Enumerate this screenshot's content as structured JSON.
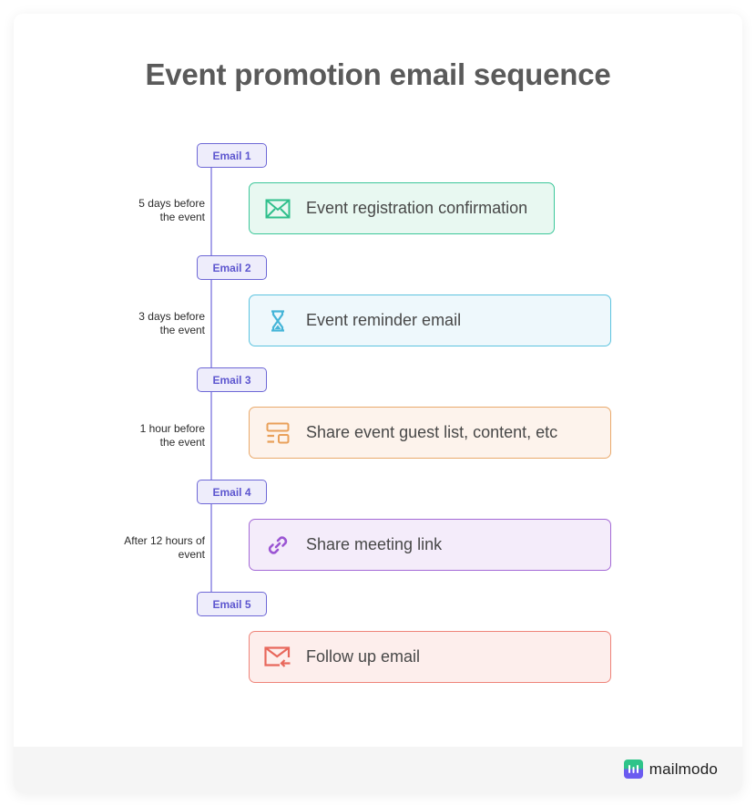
{
  "title": "Event promotion email sequence",
  "timeline": [
    {
      "badge": "Email 1",
      "timing_line1": "5 days before",
      "timing_line2": "the event",
      "step_label": "Event registration confirmation",
      "icon": "envelope-icon",
      "colors": {
        "border": "#3cc79a",
        "bg": "#e8f8f1",
        "icon": "#2fbf8c"
      }
    },
    {
      "badge": "Email 2",
      "timing_line1": "3 days before",
      "timing_line2": "the event",
      "step_label": "Event reminder email",
      "icon": "hourglass-icon",
      "colors": {
        "border": "#5cc3df",
        "bg": "#eef8fc",
        "icon": "#45b5d8"
      }
    },
    {
      "badge": "Email 3",
      "timing_line1": "1 hour before",
      "timing_line2": "the event",
      "step_label": "Share event guest list, content, etc",
      "icon": "layout-icon",
      "colors": {
        "border": "#e9a96b",
        "bg": "#fdf3ec",
        "icon": "#e9a05a"
      }
    },
    {
      "badge": "Email 4",
      "timing_line1": "After 12 hours of",
      "timing_line2": "event",
      "step_label": "Share meeting link",
      "icon": "link-icon",
      "colors": {
        "border": "#a46ad6",
        "bg": "#f4ecfa",
        "icon": "#9b55d3"
      }
    },
    {
      "badge": "Email 5",
      "timing_line1": "",
      "timing_line2": "",
      "step_label": "Follow up email",
      "icon": "mail-reply-icon",
      "colors": {
        "border": "#ee8379",
        "bg": "#fdeeec",
        "icon": "#e8685c"
      }
    }
  ],
  "accent": {
    "timeline_line": "#a9a4ea",
    "badge_border": "#6e68d6",
    "badge_bg": "#eeedfb",
    "badge_text": "#5d56cf"
  },
  "footer": {
    "brand": "mailmodo"
  }
}
